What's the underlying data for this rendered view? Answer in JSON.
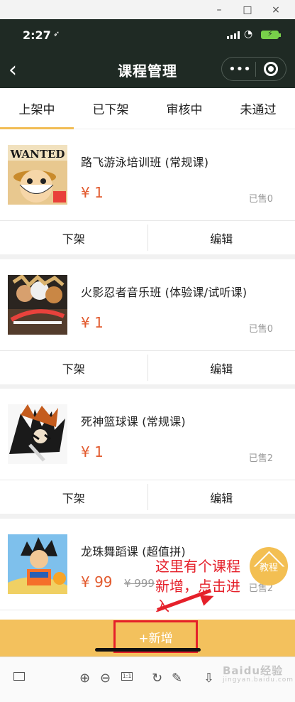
{
  "window": {
    "controls": [
      "–",
      "□",
      "×"
    ]
  },
  "phone": {
    "time": "2:27",
    "location_icon": "arrow-icon",
    "title": "课程管理",
    "capsule_menu": "•••"
  },
  "tabs": [
    {
      "label": "上架中",
      "active": true
    },
    {
      "label": "已下架",
      "active": false
    },
    {
      "label": "审核中",
      "active": false
    },
    {
      "label": "未通过",
      "active": false
    }
  ],
  "courses": [
    {
      "name": "路飞游泳培训班 (常规课)",
      "price": "¥ 1",
      "old_price": "",
      "sold": "已售0",
      "left_action": "下架",
      "right_action": "编辑"
    },
    {
      "name": "火影忍者音乐班 (体验课/试听课)",
      "price": "¥ 1",
      "old_price": "",
      "sold": "已售0",
      "left_action": "下架",
      "right_action": "编辑"
    },
    {
      "name": "死神篮球课 (常规课)",
      "price": "¥ 1",
      "old_price": "",
      "sold": "已售2",
      "left_action": "下架",
      "right_action": "编辑"
    },
    {
      "name": "龙珠舞蹈课 (超值拼)",
      "price": "¥ 99",
      "old_price": "¥ 999",
      "sold": "已售2",
      "left_action": "",
      "right_action": ""
    }
  ],
  "thumb_text": {
    "wanted": "WANTED"
  },
  "bottom": {
    "add_label": "+新增"
  },
  "annotation": {
    "line1": "这里有个课程",
    "line2": "新增，点击进",
    "line3": "入"
  },
  "tutorial_label": "教程",
  "toolbar": {
    "fit_label": "1:1"
  },
  "watermark": {
    "main": "Baidu经验",
    "sub": "jingyan.baidu.com"
  },
  "colors": {
    "accent": "#f2bd55",
    "price": "#e25b2f",
    "annotation": "#e5202a",
    "header": "#1f2a24"
  }
}
